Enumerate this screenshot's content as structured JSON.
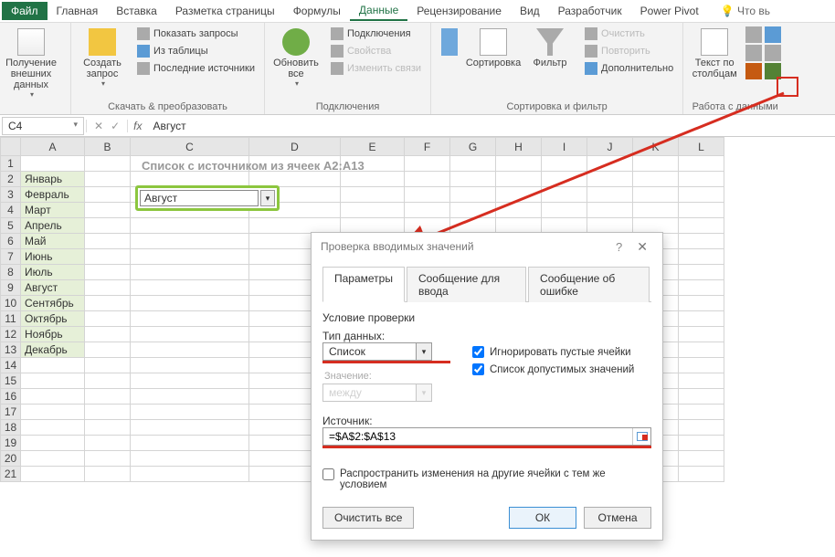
{
  "menu": {
    "file": "Файл",
    "tabs": [
      "Главная",
      "Вставка",
      "Разметка страницы",
      "Формулы",
      "Данные",
      "Рецензирование",
      "Вид",
      "Разработчик",
      "Power Pivot"
    ],
    "active": "Данные",
    "tellme": "Что вь"
  },
  "ribbon": {
    "g1": {
      "getdata": "Получение\nвнешних данных",
      "label": ""
    },
    "g2": {
      "newquery": "Создать\nзапрос",
      "showq": "Показать запросы",
      "fromtable": "Из таблицы",
      "recent": "Последние источники",
      "label": "Скачать & преобразовать"
    },
    "g3": {
      "refresh": "Обновить\nвсе",
      "conn": "Подключения",
      "props": "Свойства",
      "editlinks": "Изменить связи",
      "label": "Подключения"
    },
    "g4": {
      "sort": "Сортировка",
      "filter": "Фильтр",
      "clear": "Очистить",
      "reapply": "Повторить",
      "adv": "Дополнительно",
      "label": "Сортировка и фильтр"
    },
    "g5": {
      "ttc": "Текст по\nстолбцам",
      "label": "Работа с данными"
    }
  },
  "fxbar": {
    "namebox": "C4",
    "formula": "Август"
  },
  "cols": [
    "A",
    "B",
    "C",
    "D",
    "E",
    "F",
    "G",
    "H",
    "I",
    "J",
    "K",
    "L"
  ],
  "rows": [
    1,
    2,
    3,
    4,
    5,
    6,
    7,
    8,
    9,
    10,
    11,
    12,
    13,
    14,
    15,
    16,
    17,
    18,
    19,
    20,
    21
  ],
  "months": [
    "Январь",
    "Февраль",
    "Март",
    "Апрель",
    "Май",
    "Июнь",
    "Июль",
    "Август",
    "Сентябрь",
    "Октябрь",
    "Ноябрь",
    "Декабрь"
  ],
  "sheet_label": "Список с источником из ячеек А2:А13",
  "dropdown_value": "Август",
  "dialog": {
    "title": "Проверка вводимых значений",
    "tabs": [
      "Параметры",
      "Сообщение для ввода",
      "Сообщение об ошибке"
    ],
    "active_tab": "Параметры",
    "cond_title": "Условие проверки",
    "type_label": "Тип данных:",
    "type_value": "Список",
    "val_label": "Значение:",
    "val_value": "между",
    "ignore_blank": "Игнорировать пустые ячейки",
    "incell_dd": "Список допустимых значений",
    "src_label": "Источник:",
    "src_value": "=$A$2:$A$13",
    "propagate": "Распространить изменения на другие ячейки с тем же условием",
    "clear": "Очистить все",
    "ok": "ОК",
    "cancel": "Отмена"
  }
}
